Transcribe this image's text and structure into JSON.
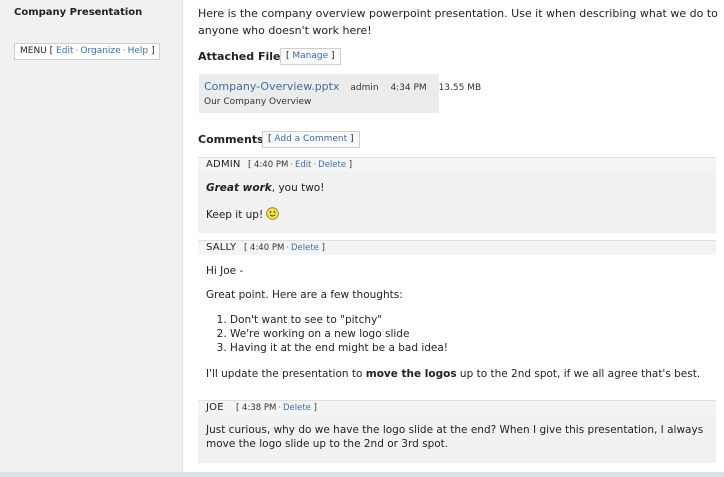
{
  "sidebar": {
    "title": "Company Presentation",
    "menu": {
      "label": "MENU",
      "items": [
        "Edit",
        "Organize",
        "Help"
      ]
    }
  },
  "main": {
    "description": "Here is the company overview powerpoint presentation. Use it when describing what we do to anyone who doesn't work here!",
    "attached_files": {
      "heading": "Attached Files",
      "manage_label": "Manage",
      "files": [
        {
          "name": "Company-Overview.pptx",
          "owner": "admin",
          "time": "4:34 PM",
          "size": "13.55 MB",
          "description": "Our Company Overview"
        }
      ]
    },
    "comments": {
      "heading": "Comments",
      "add_label": "Add a Comment",
      "list": [
        {
          "author": "ADMIN",
          "time": "4:40 PM",
          "actions": [
            "Edit",
            "Delete"
          ],
          "bold_italic": "Great work",
          "line1_rest": ", you two!",
          "line2": "Keep it up!",
          "emoji": "smiley-face-icon"
        },
        {
          "author": "SALLY",
          "time": "4:40 PM",
          "actions": [
            "Delete"
          ],
          "greeting": "Hi Joe -",
          "intro": "Great point. Here are a few thoughts:",
          "list_items": [
            "Don't want to see to \"pitchy\"",
            "We're working on a new logo slide",
            "Having it at the end might be a bad idea!"
          ],
          "closing_before": "I'll update the presentation to ",
          "closing_bold": "move the logos",
          "closing_after": " up to the 2nd spot, if we all agree that's best."
        },
        {
          "author": "JOE",
          "time": "4:38 PM",
          "actions": [
            "Delete"
          ],
          "body": "Just curious, why do we have the logo slide at the end? When I give this presentation, I always move the logo slide up to the 2nd or 3rd spot."
        }
      ]
    }
  },
  "colors": {
    "link": "#3a6fa5",
    "sidebar_bg": "#f1f1f1",
    "comment_shade": "#f1f1f1",
    "bottom_strip": "#d9e2ea"
  }
}
